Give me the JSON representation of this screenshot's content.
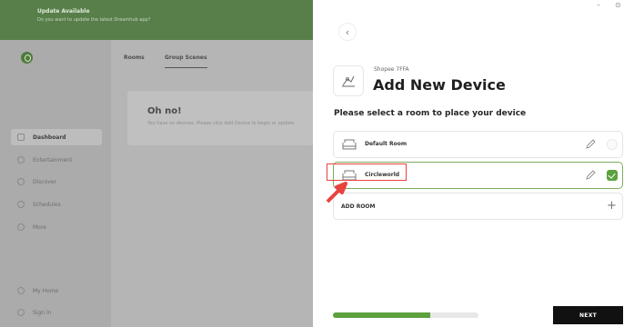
{
  "banner": {
    "title": "Update Available",
    "subtitle": "Do you want to update the latest Dreamhub app?"
  },
  "sidebar": {
    "items": [
      {
        "label": "Dashboard",
        "icon": "grid-icon",
        "active": true
      },
      {
        "label": "Entertainment",
        "icon": "tv-icon"
      },
      {
        "label": "Discover",
        "icon": "compass-icon"
      },
      {
        "label": "Schedules",
        "icon": "calendar-icon"
      },
      {
        "label": "More",
        "icon": "more-icon"
      }
    ],
    "footer": [
      {
        "label": "My Home",
        "icon": "home-icon"
      },
      {
        "label": "Sign In",
        "icon": "user-icon"
      }
    ]
  },
  "topnav": {
    "tabs": [
      "Rooms",
      "Group Scenes"
    ],
    "active_tab": "Group Scenes"
  },
  "empty_state": {
    "title": "Oh no!",
    "text": "You have no devices. Please click Add Device to begin or update."
  },
  "panel": {
    "back_icon": "chevron-left-icon",
    "device_model": "Shopee 7FFA",
    "title": "Add New Device",
    "instruction": "Please select a room to place your device",
    "rooms": [
      {
        "name": "Default Room",
        "selected": false
      },
      {
        "name": "Circleworld",
        "selected": true
      }
    ],
    "add_room_label": "ADD ROOM",
    "progress": 0.67,
    "next_label": "NEXT"
  },
  "window_controls": {
    "minimize": "–",
    "close": "⊙"
  },
  "colors": {
    "accent": "#5ca13e",
    "banner": "#587f4a",
    "highlight": "#e8433f"
  }
}
